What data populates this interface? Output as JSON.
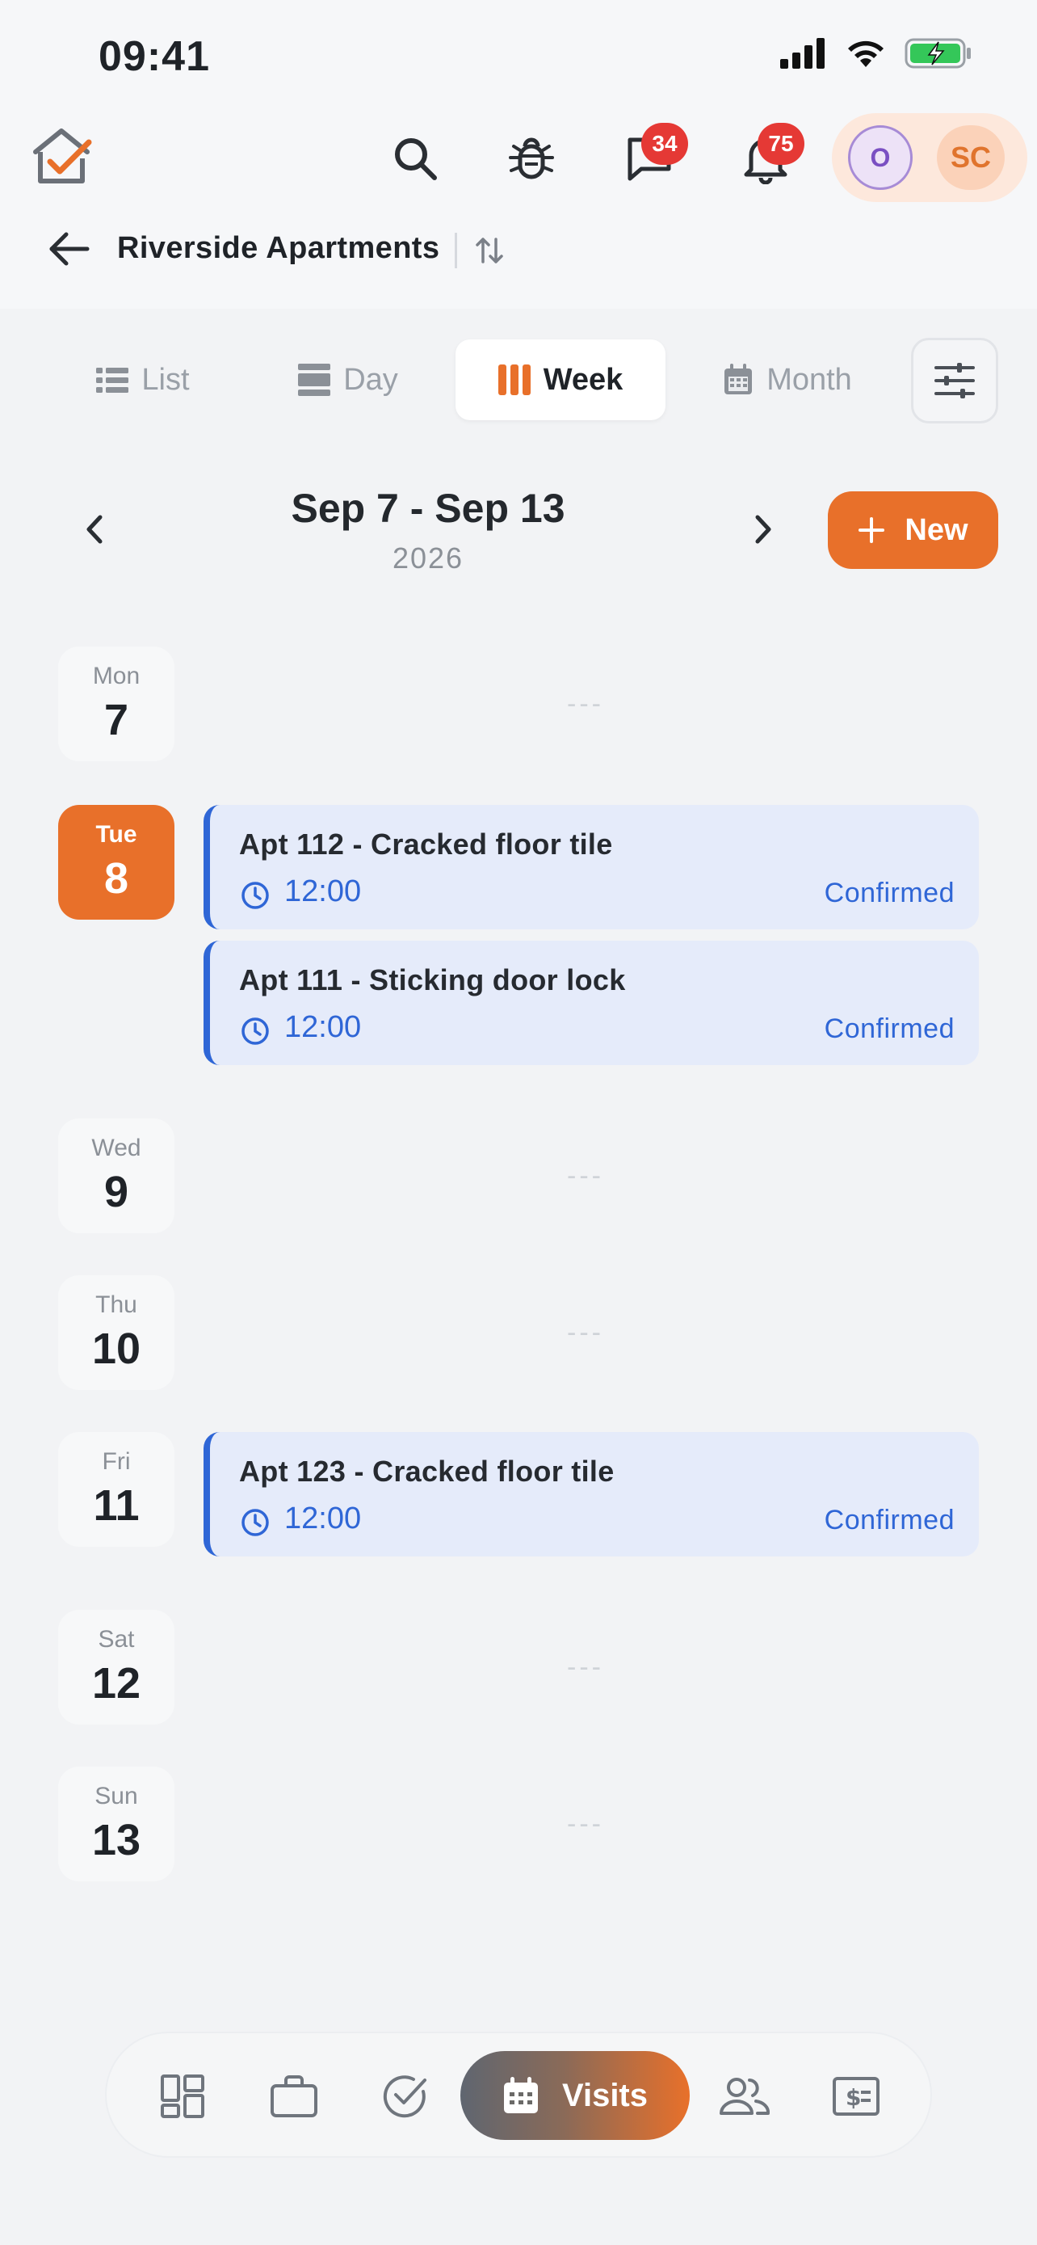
{
  "status_bar": {
    "time": "09:41"
  },
  "header": {
    "messages_badge": "34",
    "notifications_badge": "75",
    "avatars": [
      "O",
      "SC"
    ]
  },
  "property": {
    "title": "Riverside Apartments"
  },
  "view_tabs": [
    {
      "label": "List",
      "active": false
    },
    {
      "label": "Day",
      "active": false
    },
    {
      "label": "Week",
      "active": true
    },
    {
      "label": "Month",
      "active": false
    }
  ],
  "range": {
    "title": "Sep 7 - Sep 13",
    "year": "2026",
    "new_label": "New"
  },
  "empty_marker": "---",
  "days": [
    {
      "dow": "Mon",
      "num": "7"
    },
    {
      "dow": "Tue",
      "num": "8"
    },
    {
      "dow": "Wed",
      "num": "9"
    },
    {
      "dow": "Thu",
      "num": "10"
    },
    {
      "dow": "Fri",
      "num": "11"
    },
    {
      "dow": "Sat",
      "num": "12"
    },
    {
      "dow": "Sun",
      "num": "13"
    }
  ],
  "events": [
    {
      "title": "Apt 112 - Cracked floor tile",
      "time": "12:00",
      "status": "Confirmed"
    },
    {
      "title": "Apt 111 - Sticking door lock",
      "time": "12:00",
      "status": "Confirmed"
    },
    {
      "title": "Apt 123 - Cracked floor tile",
      "time": "12:00",
      "status": "Confirmed"
    }
  ],
  "bottom_nav": {
    "active_label": "Visits"
  },
  "colors": {
    "accent": "#e8702a",
    "event_blue": "#2f66d6",
    "event_bg": "#e5ebfa",
    "badge_red": "#e53935"
  }
}
